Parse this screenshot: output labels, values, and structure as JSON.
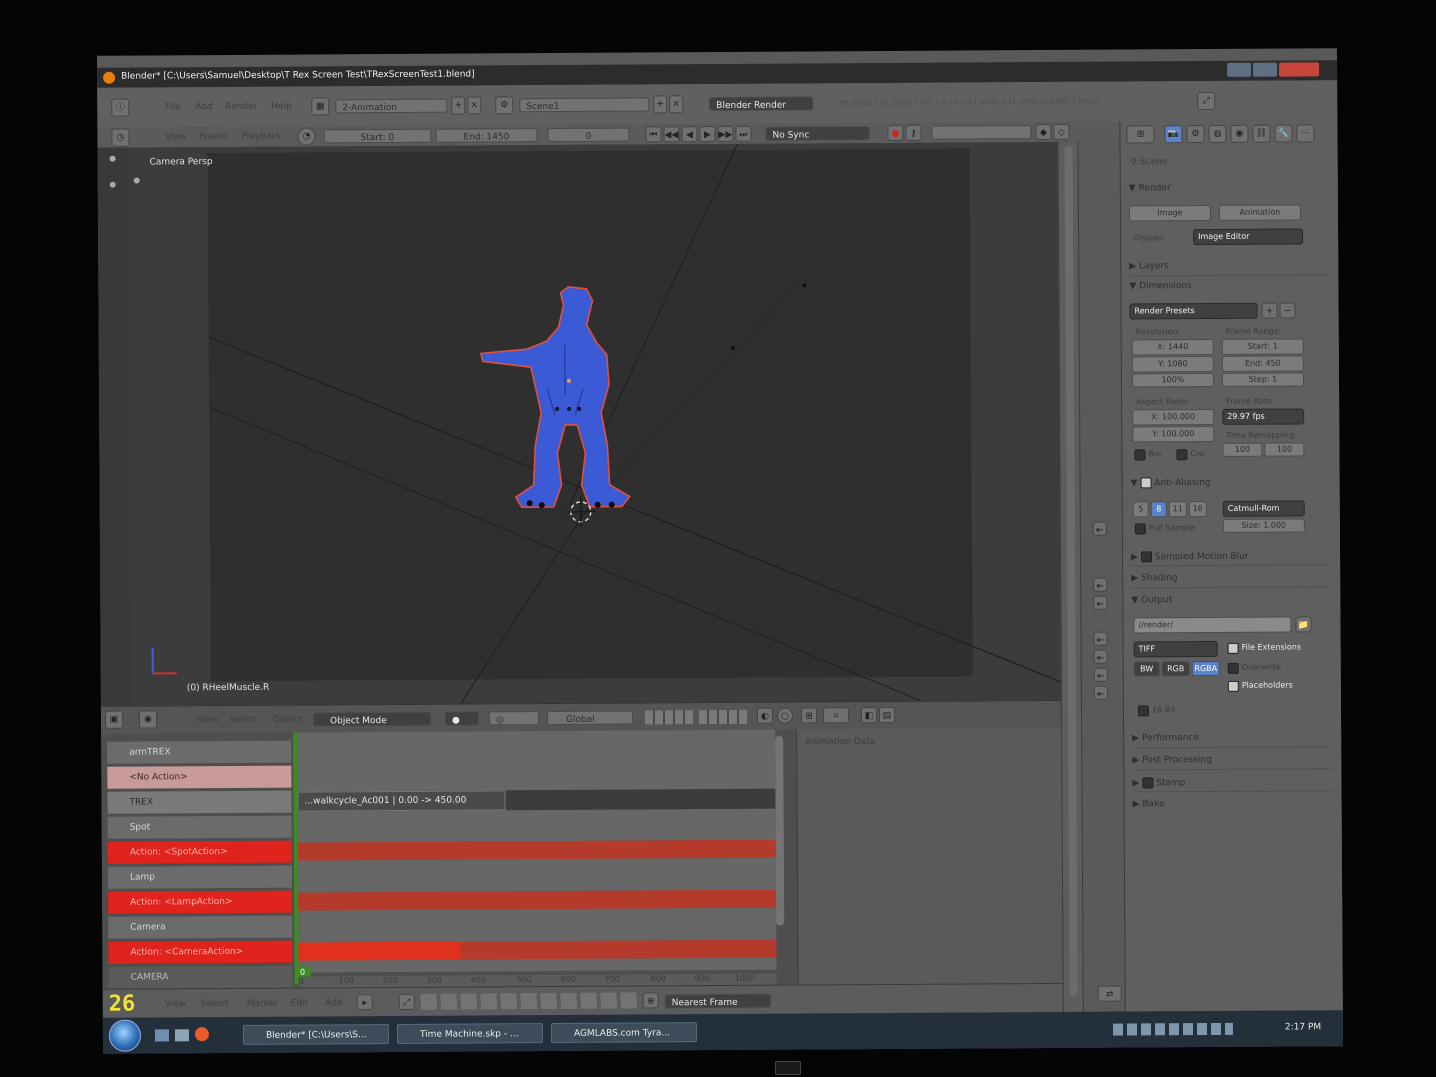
{
  "window": {
    "title": "Blender* [C:\\Users\\Samuel\\Desktop\\T Rex Screen Test\\TRexScreenTest1.blend]"
  },
  "info_header": {
    "menus": [
      "File",
      "Add",
      "Render",
      "Help"
    ],
    "screen_layout": "2-Animation",
    "scene": "Scene1",
    "render_engine": "Blender Render",
    "stats": "Ve:5853 | Fa:5695 | Ob:1-9 | La:5 | Mem:131.14M (0.16M) | Mesh"
  },
  "timeline_header": {
    "menus": [
      "View",
      "Frame",
      "Playback"
    ],
    "start": "Start: 0",
    "end": "End: 1450",
    "current": "0",
    "sync": "No Sync"
  },
  "viewport": {
    "label": "Camera Persp",
    "object_label": "(0) RHeelMuscle.R"
  },
  "view3d_header": {
    "menus": [
      "View",
      "Select",
      "Object"
    ],
    "mode": "Object Mode",
    "orientation": "Global"
  },
  "nla": {
    "channels": [
      {
        "label": "armTREX",
        "kind": "object"
      },
      {
        "label": "<No Action>",
        "kind": "noaction"
      },
      {
        "label": "TREX",
        "kind": "track"
      },
      {
        "label": "Spot",
        "kind": "object"
      },
      {
        "label": "Action: <SpotAction>",
        "kind": "action"
      },
      {
        "label": "Lamp",
        "kind": "object"
      },
      {
        "label": "Action: <LampAction>",
        "kind": "action"
      },
      {
        "label": "Camera",
        "kind": "object"
      },
      {
        "label": "Action: <CameraAction>",
        "kind": "action"
      },
      {
        "label": "CAMERA",
        "kind": "track"
      }
    ],
    "strip_label": "...walkcycle_Ac001 | 0.00 -> 450.00",
    "side_panel": "Animation Data",
    "ruler": [
      "0",
      "100",
      "200",
      "300",
      "400",
      "500",
      "600",
      "700",
      "800",
      "900",
      "1000"
    ],
    "footer_menus": [
      "View",
      "Select",
      "Marker",
      "Edit",
      "Add"
    ],
    "snap": "Nearest Frame",
    "current_frame_display": "26",
    "cursor_marker": "0"
  },
  "properties": {
    "scene_label": "Scene",
    "render_panel": "Render",
    "image_btn": "Image",
    "animation_btn": "Animation",
    "display_label": "Display:",
    "display_value": "Image Editor",
    "layers": "Layers",
    "dimensions": "Dimensions",
    "render_presets": "Render Presets",
    "resolution_label": "Resolution:",
    "res_x": "X: 1440",
    "res_y": "Y: 1080",
    "res_pct": "100%",
    "frame_range_label": "Frame Range:",
    "start": "Start: 1",
    "end": "End: 450",
    "step": "Step: 1",
    "aspect_label": "Aspect Ratio:",
    "asp_x": "X: 100.000",
    "asp_y": "Y: 100.000",
    "border": "Bor",
    "crop": "Cro",
    "frame_rate_label": "Frame Rate:",
    "fps": "29.97 fps",
    "time_remap_label": "Time Remapping:",
    "remap_old": "100",
    "remap_new": "100",
    "anti_aliasing": "Anti-Aliasing",
    "aa_samples": [
      "5",
      "8",
      "11",
      "16"
    ],
    "aa_filter": "Catmull-Rom",
    "full_sample": "Full Sample",
    "aa_size": "Size: 1.000",
    "sampled_motion_blur": "Sampled Motion Blur",
    "shading": "Shading",
    "output": "Output",
    "output_path": "//render/",
    "format": "TIFF",
    "file_ext": "File Extensions",
    "bw": "BW",
    "rgb": "RGB",
    "rgba": "RGBA",
    "overwrite": "Overwrite",
    "placeholders": "Placeholders",
    "bit16": "16 Bit",
    "performance": "Performance",
    "post_processing": "Post Processing",
    "stamp": "Stamp",
    "bake": "Bake"
  },
  "taskbar": {
    "items": [
      "Blender* [C:\\Users\\S...",
      "Time Machine.skp - ...",
      "AGMLABS.com Tyra..."
    ],
    "clock": "2:17 PM"
  },
  "colors": {
    "accent_orange": "#e87d0d",
    "action_red": "#e0231c",
    "playhead_green": "#3b8d20",
    "selected_blue": "#5a82c8",
    "trex_blue": "#3b5bd6"
  }
}
